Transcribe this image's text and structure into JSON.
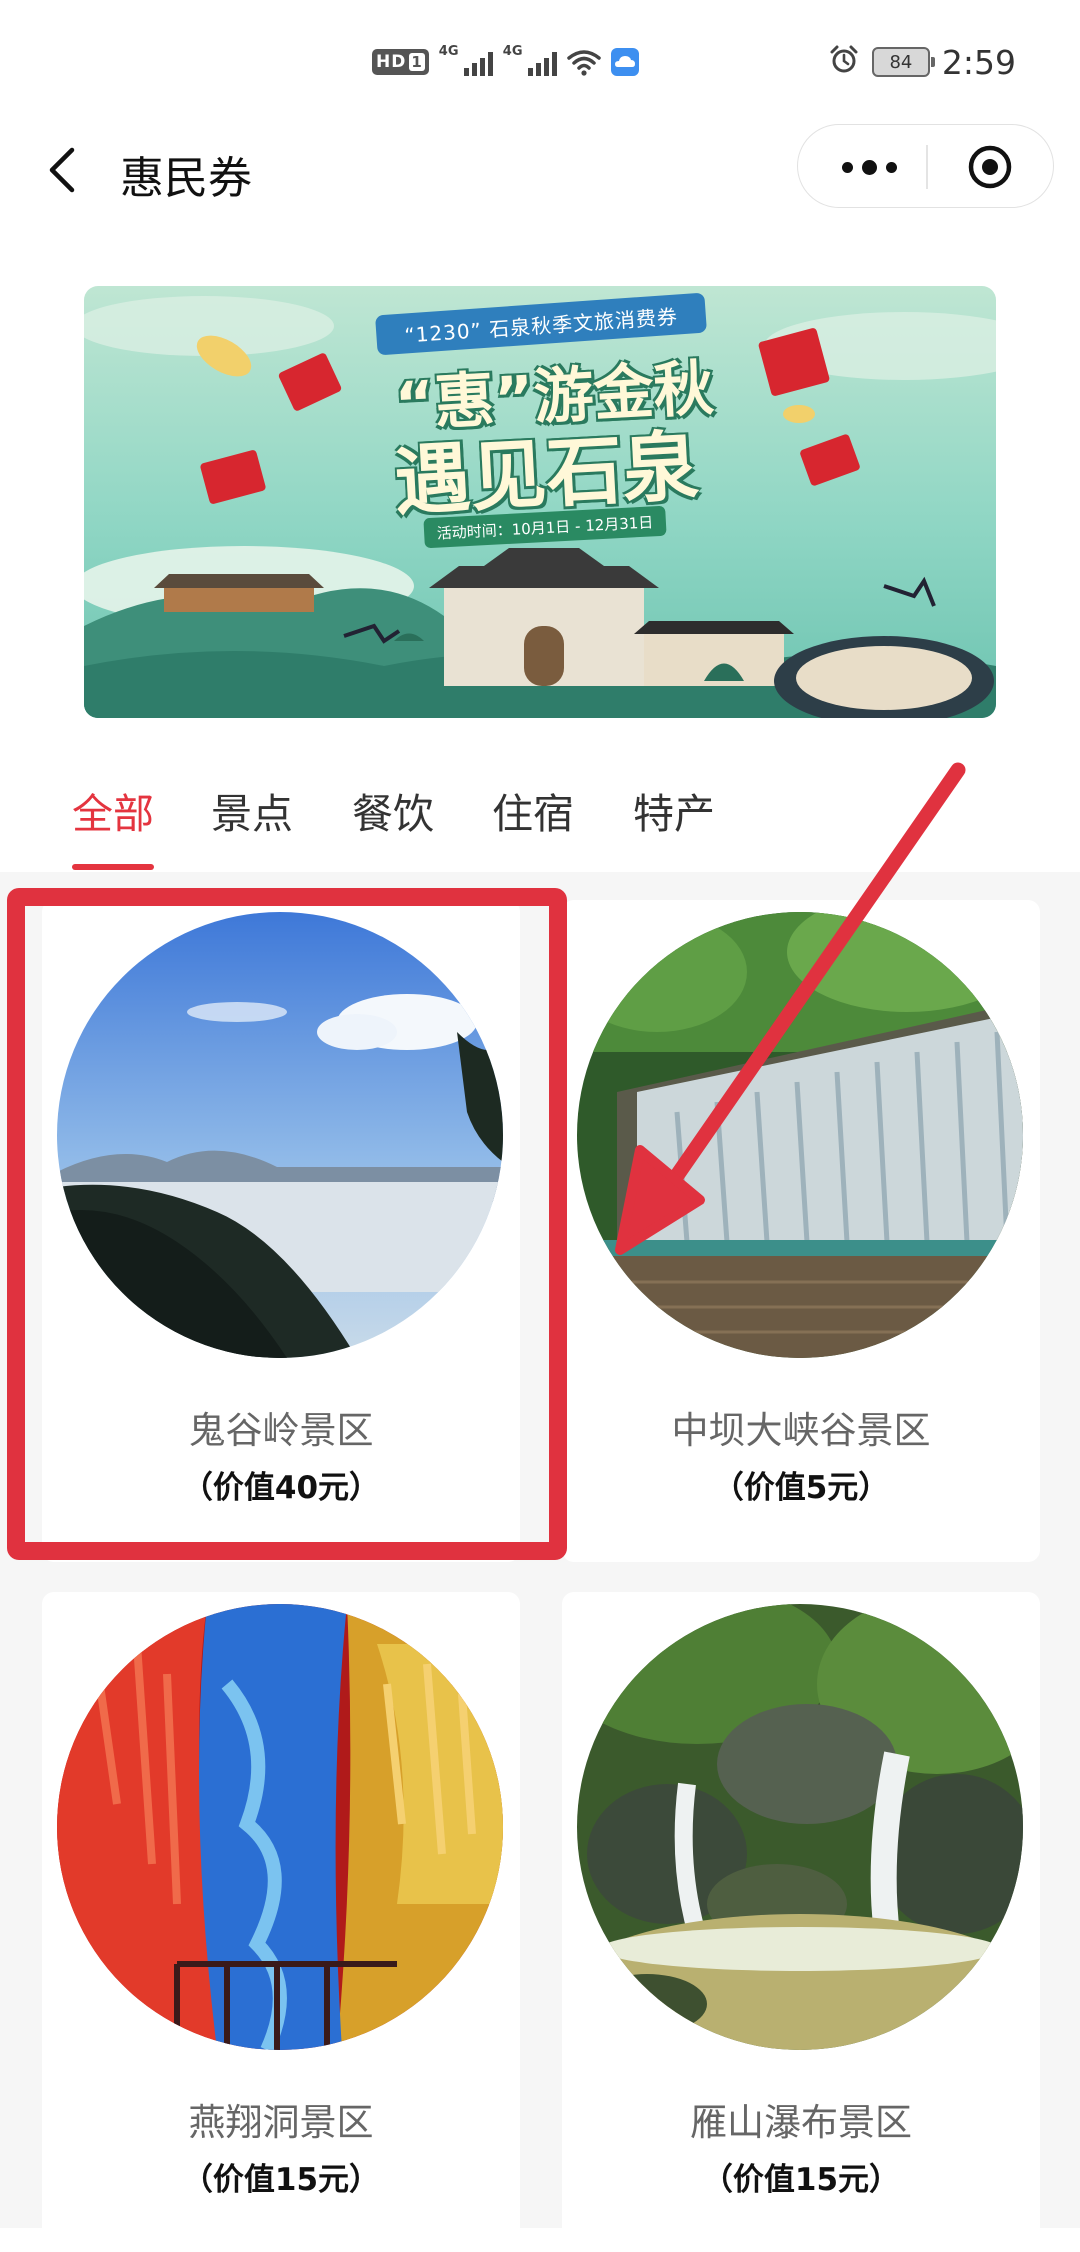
{
  "status_bar": {
    "hd_label": "HD",
    "sim_label": "1",
    "network_1": "4G",
    "network_2": "4G",
    "battery_level": "84",
    "time": "2:59"
  },
  "nav": {
    "title": "惠民券"
  },
  "banner": {
    "tag": "“1230” 石泉秋季文旅消费券",
    "headline_1": "“惠”游金秋",
    "headline_2": "遇见石泉",
    "date": "活动时间：10月1日 - 12月31日"
  },
  "tabs": [
    {
      "label": "全部",
      "active": true
    },
    {
      "label": "景点",
      "active": false
    },
    {
      "label": "餐饮",
      "active": false
    },
    {
      "label": "住宿",
      "active": false
    },
    {
      "label": "特产",
      "active": false
    }
  ],
  "cards": [
    {
      "name": "鬼谷岭景区",
      "value": "（价值40元）",
      "image": "mountain-sea-of-clouds"
    },
    {
      "name": "中坝大峡谷景区",
      "value": "（价值5元）",
      "image": "waterfall-over-pool"
    },
    {
      "name": "燕翔洞景区",
      "value": "（价值15元）",
      "image": "illuminated-karst-cave"
    },
    {
      "name": "雁山瀑布景区",
      "value": "（价值15元）",
      "image": "forest-waterfall"
    }
  ],
  "colors": {
    "accent": "#e4343f",
    "annotation": "#e0323f"
  }
}
